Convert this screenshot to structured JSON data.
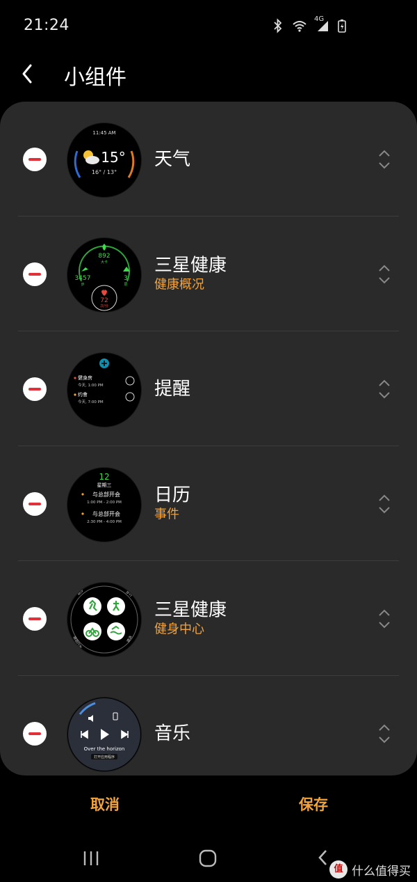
{
  "status_bar": {
    "time": "21:24",
    "network": "4G",
    "battery_icon": "battery-charging-icon"
  },
  "header": {
    "title": "小组件",
    "back_icon": "back-arrow-icon"
  },
  "widgets": [
    {
      "title": "天气",
      "subtitle": "",
      "preview": {
        "time": "11:45 AM",
        "temp": "15°",
        "range": "16° / 13°"
      }
    },
    {
      "title": "三星健康",
      "subtitle": "健康概况",
      "preview": {
        "calories": "892",
        "calories_unit": "大卡",
        "steps": "3457",
        "steps_unit": "步",
        "floors": "3",
        "floors_unit": "层",
        "heart": "72",
        "heart_unit": "次/分"
      }
    },
    {
      "title": "提醒",
      "subtitle": "",
      "preview": {
        "item1": "健身房",
        "item1_time": "今天, 1:00 PM",
        "item2": "约會",
        "item2_time": "今天, 7:00 PM"
      }
    },
    {
      "title": "日历",
      "subtitle": "事件",
      "preview": {
        "day": "12",
        "weekday": "星期三",
        "event1": "与总部开会",
        "event1_time": "1:00 PM - 2:00 PM",
        "event2": "与总部开会",
        "event2_time": "2:30 PM - 4:00 PM"
      }
    },
    {
      "title": "三星健康",
      "subtitle": "健身中心",
      "preview": {
        "tl": "跑步",
        "tr": "步行",
        "bl": "骑自行车",
        "br": "游泳"
      }
    },
    {
      "title": "音乐",
      "subtitle": "",
      "preview": {
        "song": "Over the horizon",
        "action": "打开应用程序"
      }
    }
  ],
  "actions": {
    "cancel": "取消",
    "save": "保存"
  },
  "watermark": {
    "logo": "值",
    "text": "什么值得买"
  },
  "colors": {
    "accent": "#f2a33c",
    "card": "#2a2a2a",
    "remove": "#e0313a",
    "health_green": "#3ddc4a"
  }
}
